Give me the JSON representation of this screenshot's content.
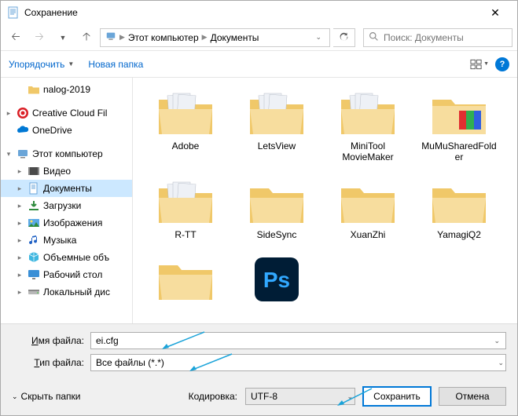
{
  "window": {
    "title": "Сохранение"
  },
  "nav": {
    "breadcrumb": [
      "Этот компьютер",
      "Документы"
    ],
    "search_placeholder": "Поиск: Документы"
  },
  "toolbar": {
    "organize": "Упорядочить",
    "new_folder": "Новая папка",
    "help": "?"
  },
  "sidebar": {
    "items": [
      {
        "label": "nalog-2019",
        "icon": "folder",
        "level": 2,
        "caret": ""
      },
      {
        "label": "Creative Cloud Fil",
        "icon": "cc",
        "level": 1,
        "caret": ">"
      },
      {
        "label": "OneDrive",
        "icon": "onedrive",
        "level": 1,
        "caret": ""
      },
      {
        "label": "Этот компьютер",
        "icon": "pc",
        "level": 1,
        "caret": "v"
      },
      {
        "label": "Видео",
        "icon": "video",
        "level": 2,
        "caret": ">"
      },
      {
        "label": "Документы",
        "icon": "docs",
        "level": 2,
        "caret": ">",
        "selected": true
      },
      {
        "label": "Загрузки",
        "icon": "downloads",
        "level": 2,
        "caret": ">"
      },
      {
        "label": "Изображения",
        "icon": "images",
        "level": 2,
        "caret": ">"
      },
      {
        "label": "Музыка",
        "icon": "music",
        "level": 2,
        "caret": ">"
      },
      {
        "label": "Объемные объ",
        "icon": "3d",
        "level": 2,
        "caret": ">"
      },
      {
        "label": "Рабочий стол",
        "icon": "desktop",
        "level": 2,
        "caret": ">"
      },
      {
        "label": "Локальный дис",
        "icon": "disk",
        "level": 2,
        "caret": ">"
      }
    ]
  },
  "content": {
    "items": [
      {
        "label": "Adobe",
        "kind": "folder-docs"
      },
      {
        "label": "LetsView",
        "kind": "folder-docs"
      },
      {
        "label": "MiniTool MovieMaker",
        "kind": "folder-docs"
      },
      {
        "label": "MuMuSharedFolder",
        "kind": "folder-special"
      },
      {
        "label": "R-TT",
        "kind": "folder-docs"
      },
      {
        "label": "SideSync",
        "kind": "folder"
      },
      {
        "label": "XuanZhi",
        "kind": "folder"
      },
      {
        "label": "YamagiQ2",
        "kind": "folder"
      },
      {
        "label": "",
        "kind": "folder"
      },
      {
        "label": "",
        "kind": "ps"
      }
    ]
  },
  "fields": {
    "filename_label_pre": "Имя файла:",
    "filename_value": "ei.cfg",
    "filetype_label_pre": "Тип файла:",
    "filetype_value": "Все файлы  (*.*)"
  },
  "footer": {
    "hide_folders": "Скрыть папки",
    "encoding_label": "Кодировка:",
    "encoding_value": "UTF-8",
    "save": "Сохранить",
    "cancel": "Отмена"
  }
}
